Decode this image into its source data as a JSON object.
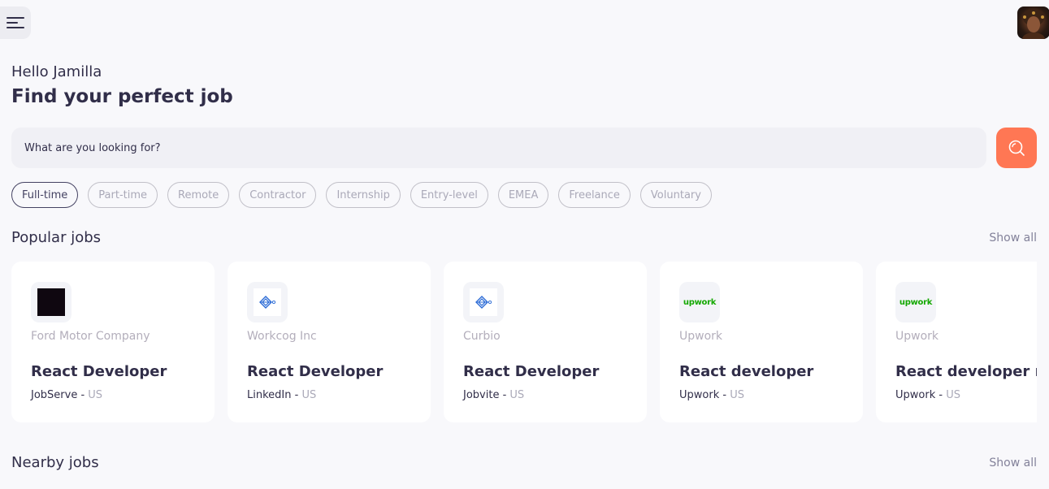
{
  "header": {
    "menu_icon": "hamburger-menu-icon",
    "avatar_alt": "profile-avatar"
  },
  "welcome": {
    "greeting": "Hello Jamilla",
    "headline": "Find your perfect job"
  },
  "search": {
    "placeholder": "What are you looking for?",
    "button_icon": "search-icon",
    "button_color": "#ff7754"
  },
  "job_types": [
    {
      "label": "Full-time",
      "active": true
    },
    {
      "label": "Part-time",
      "active": false
    },
    {
      "label": "Remote",
      "active": false
    },
    {
      "label": "Contractor",
      "active": false
    },
    {
      "label": "Internship",
      "active": false
    },
    {
      "label": "Entry-level",
      "active": false
    },
    {
      "label": "EMEA",
      "active": false
    },
    {
      "label": "Freelance",
      "active": false
    },
    {
      "label": "Voluntary",
      "active": false
    }
  ],
  "popular": {
    "title": "Popular jobs",
    "show_all": "Show all",
    "jobs": [
      {
        "company": "Ford Motor Company",
        "title": "React Developer",
        "publisher": "JobServe",
        "separator": " - ",
        "location": "US",
        "logo": "black-square-logo"
      },
      {
        "company": "Workcog Inc",
        "title": "React Developer",
        "publisher": "LinkedIn",
        "separator": " - ",
        "location": "US",
        "logo": "blue-cube-logo"
      },
      {
        "company": "Curbio",
        "title": "React Developer",
        "publisher": "Jobvite",
        "separator": " - ",
        "location": "US",
        "logo": "blue-cube-logo"
      },
      {
        "company": "Upwork",
        "title": "React developer",
        "publisher": "Upwork",
        "separator": " - ",
        "location": "US",
        "logo": "upwork-logo",
        "logo_text": "upwork"
      },
      {
        "company": "Upwork",
        "title": "React developer ne",
        "publisher": "Upwork",
        "separator": " - ",
        "location": "US",
        "logo": "upwork-logo",
        "logo_text": "upwork"
      }
    ]
  },
  "nearby": {
    "title": "Nearby jobs",
    "show_all": "Show all"
  },
  "colors": {
    "background": "#f8f8fb",
    "primary_text": "#312e49",
    "accent": "#ff7754",
    "muted_text": "#b3aebb",
    "upwork_green": "#14a800"
  }
}
